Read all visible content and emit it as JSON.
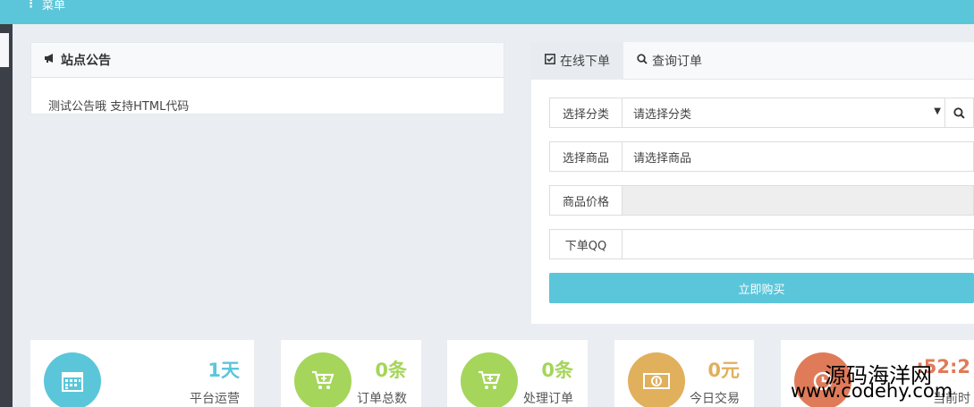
{
  "topbar": {
    "menu_icon": "bars-icon",
    "menu_label": "菜单",
    "bg_color": "#5bc6da"
  },
  "notice": {
    "title": "站点公告",
    "icon": "bullhorn-icon",
    "content": "测试公告哦 支持HTML代码"
  },
  "order": {
    "tabs": [
      {
        "label": "在线下单",
        "icon": "check-square-icon",
        "active": true
      },
      {
        "label": "查询订单",
        "icon": "search-icon",
        "active": false
      }
    ],
    "fields": [
      {
        "label": "选择分类",
        "value": "请选择分类",
        "type": "select"
      },
      {
        "label": "选择商品",
        "value": "请选择商品",
        "type": "select"
      },
      {
        "label": "商品价格",
        "value": "",
        "type": "disabled"
      },
      {
        "label": "下单QQ",
        "value": "",
        "type": "input"
      }
    ],
    "buy_label": "立即购买"
  },
  "stats": [
    {
      "value": "1天",
      "label": "平台运营",
      "icon": "calendar-icon",
      "color": "#5bc6da"
    },
    {
      "value": "0条",
      "label": "订单总数",
      "icon": "cart-plus-icon",
      "color": "#a5d55a"
    },
    {
      "value": "0条",
      "label": "处理订单",
      "icon": "cart-plus-icon",
      "color": "#a5d55a"
    },
    {
      "value": "0元",
      "label": "今日交易",
      "icon": "money-icon",
      "color": "#e0b05c"
    },
    {
      "value": ":52:2",
      "label": "当前时",
      "icon": "clock-icon",
      "color": "#e07b5a"
    }
  ],
  "watermark": {
    "line1": "源码海洋网",
    "line2": "www.codehy.com"
  }
}
